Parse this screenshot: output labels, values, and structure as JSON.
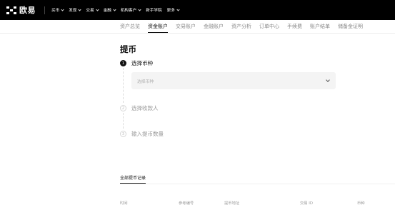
{
  "brand": {
    "name": "欧易"
  },
  "topnav": {
    "items": [
      {
        "label": "买币",
        "has_dropdown": true
      },
      {
        "label": "发现",
        "has_dropdown": true
      },
      {
        "label": "交易",
        "has_dropdown": true
      },
      {
        "label": "金融",
        "has_dropdown": true
      },
      {
        "label": "机构客户",
        "has_dropdown": true
      },
      {
        "label": "新手学院",
        "has_dropdown": false
      },
      {
        "label": "更多",
        "has_dropdown": true
      }
    ]
  },
  "subnav": {
    "items": [
      {
        "label": "资产总览",
        "active": false
      },
      {
        "label": "资金账户",
        "active": true
      },
      {
        "label": "交易账户",
        "active": false
      },
      {
        "label": "金融账户",
        "active": false
      },
      {
        "label": "资产分析",
        "active": false
      },
      {
        "label": "订单中心",
        "active": false
      },
      {
        "label": "手续费",
        "active": false
      },
      {
        "label": "账户结单",
        "active": false
      },
      {
        "label": "储备金证明",
        "active": false
      }
    ]
  },
  "page": {
    "title": "提币"
  },
  "steps": [
    {
      "number": "1",
      "label": "选择币种",
      "active": true
    },
    {
      "number": "2",
      "label": "选择收款人",
      "active": false
    },
    {
      "number": "3",
      "label": "输入提币数量",
      "active": false
    }
  ],
  "coin_select": {
    "placeholder": "选择币种"
  },
  "records": {
    "title": "全部提币记录",
    "columns": [
      "时间",
      "参考编号",
      "提币地址",
      "交易 ID",
      "币种"
    ]
  },
  "colors": {
    "nav_bg": "#000000",
    "accent": "#111111",
    "muted": "#9a9a9a",
    "field_bg": "#f4f4f4"
  }
}
